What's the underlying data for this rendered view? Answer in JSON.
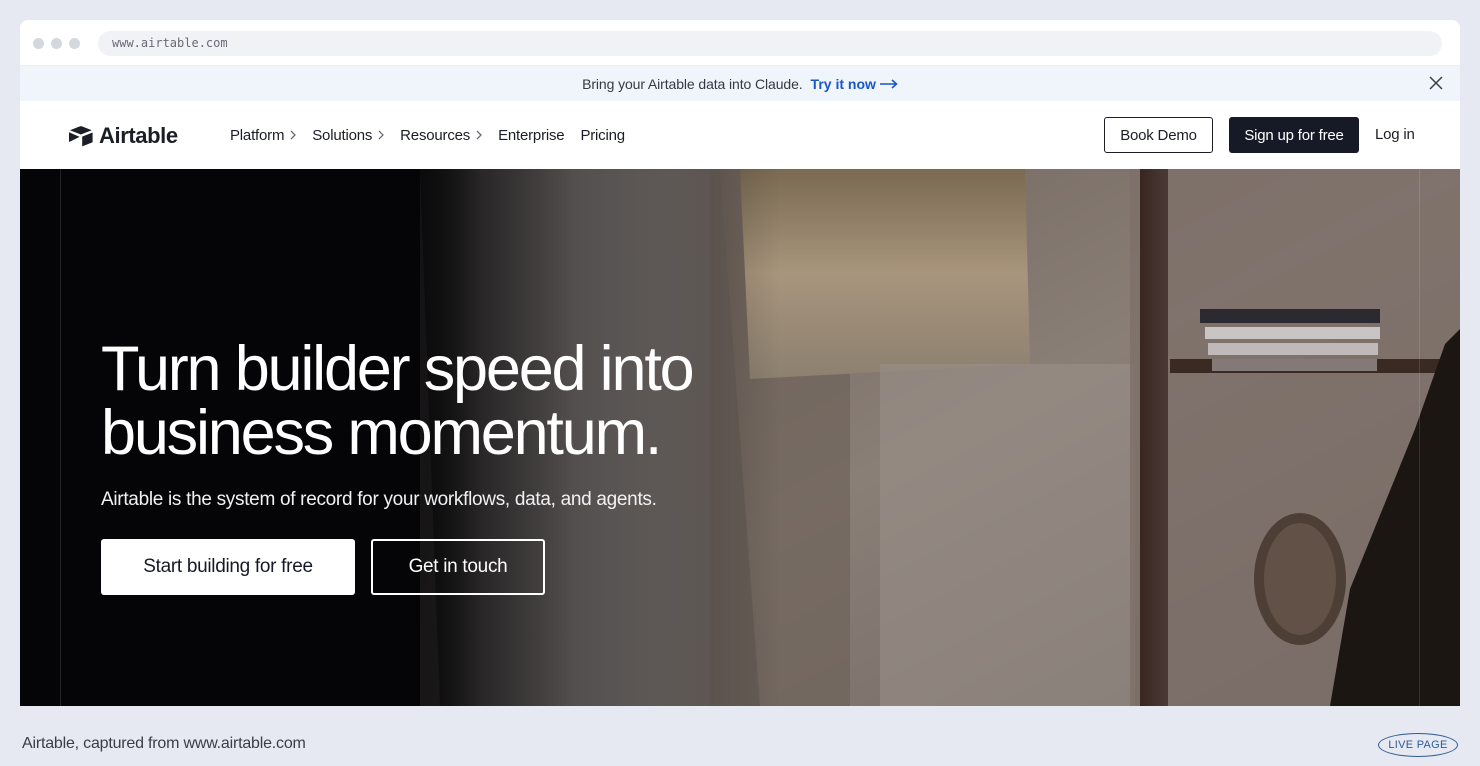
{
  "browser": {
    "url": "www.airtable.com"
  },
  "banner": {
    "text": "Bring your Airtable data into Claude.",
    "link": "Try it now"
  },
  "nav": {
    "logo_text": "Airtable",
    "items": [
      {
        "label": "Platform"
      },
      {
        "label": "Solutions"
      },
      {
        "label": "Resources"
      },
      {
        "label": "Enterprise"
      },
      {
        "label": "Pricing"
      }
    ],
    "book_demo": "Book Demo",
    "signup": "Sign up for free",
    "login": "Log in"
  },
  "hero": {
    "headline_line1": "Turn builder speed into",
    "headline_line2": "business momentum.",
    "subheadline": "Airtable is the system of record for your workflows, data, and agents.",
    "primary_cta": "Start building for free",
    "secondary_cta": "Get in touch"
  },
  "footer": {
    "caption": "Airtable, captured from www.airtable.com",
    "badge": "LIVE PAGE"
  },
  "colors": {
    "banner_bg": "#f0f5fc",
    "banner_link": "#1a56c9",
    "dark_button": "#161a27",
    "hero_bg": "#050507"
  }
}
